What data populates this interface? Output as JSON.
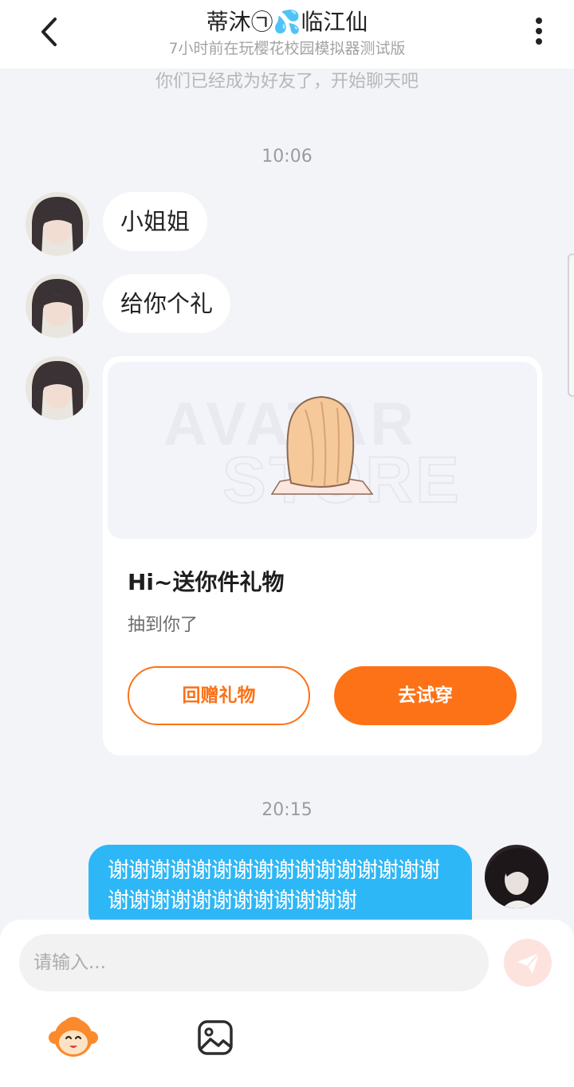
{
  "header": {
    "title": "蒂沐㉠💦临江仙",
    "subtitle": "7小时前在玩樱花校园模拟器测试版"
  },
  "chat": {
    "system_notice": "你们已经成为好友了，开始聊天吧",
    "time1": "10:06",
    "msg1": "小姐姐",
    "msg2": "给你个礼",
    "gift": {
      "banner_text": "AVATAR STORE",
      "title": "Hi~送你件礼物",
      "description": "抽到你了",
      "return_button": "回赠礼物",
      "try_button": "去试穿"
    },
    "time2": "20:15",
    "msg_out": "谢谢谢谢谢谢谢谢谢谢谢谢谢谢谢谢谢谢谢谢谢谢谢谢谢谢谢谢"
  },
  "composer": {
    "placeholder": "请输入..."
  },
  "colors": {
    "accent_orange": "#fd7216",
    "outgoing_bubble": "#2eb7f6",
    "background": "#f3f4f8"
  }
}
